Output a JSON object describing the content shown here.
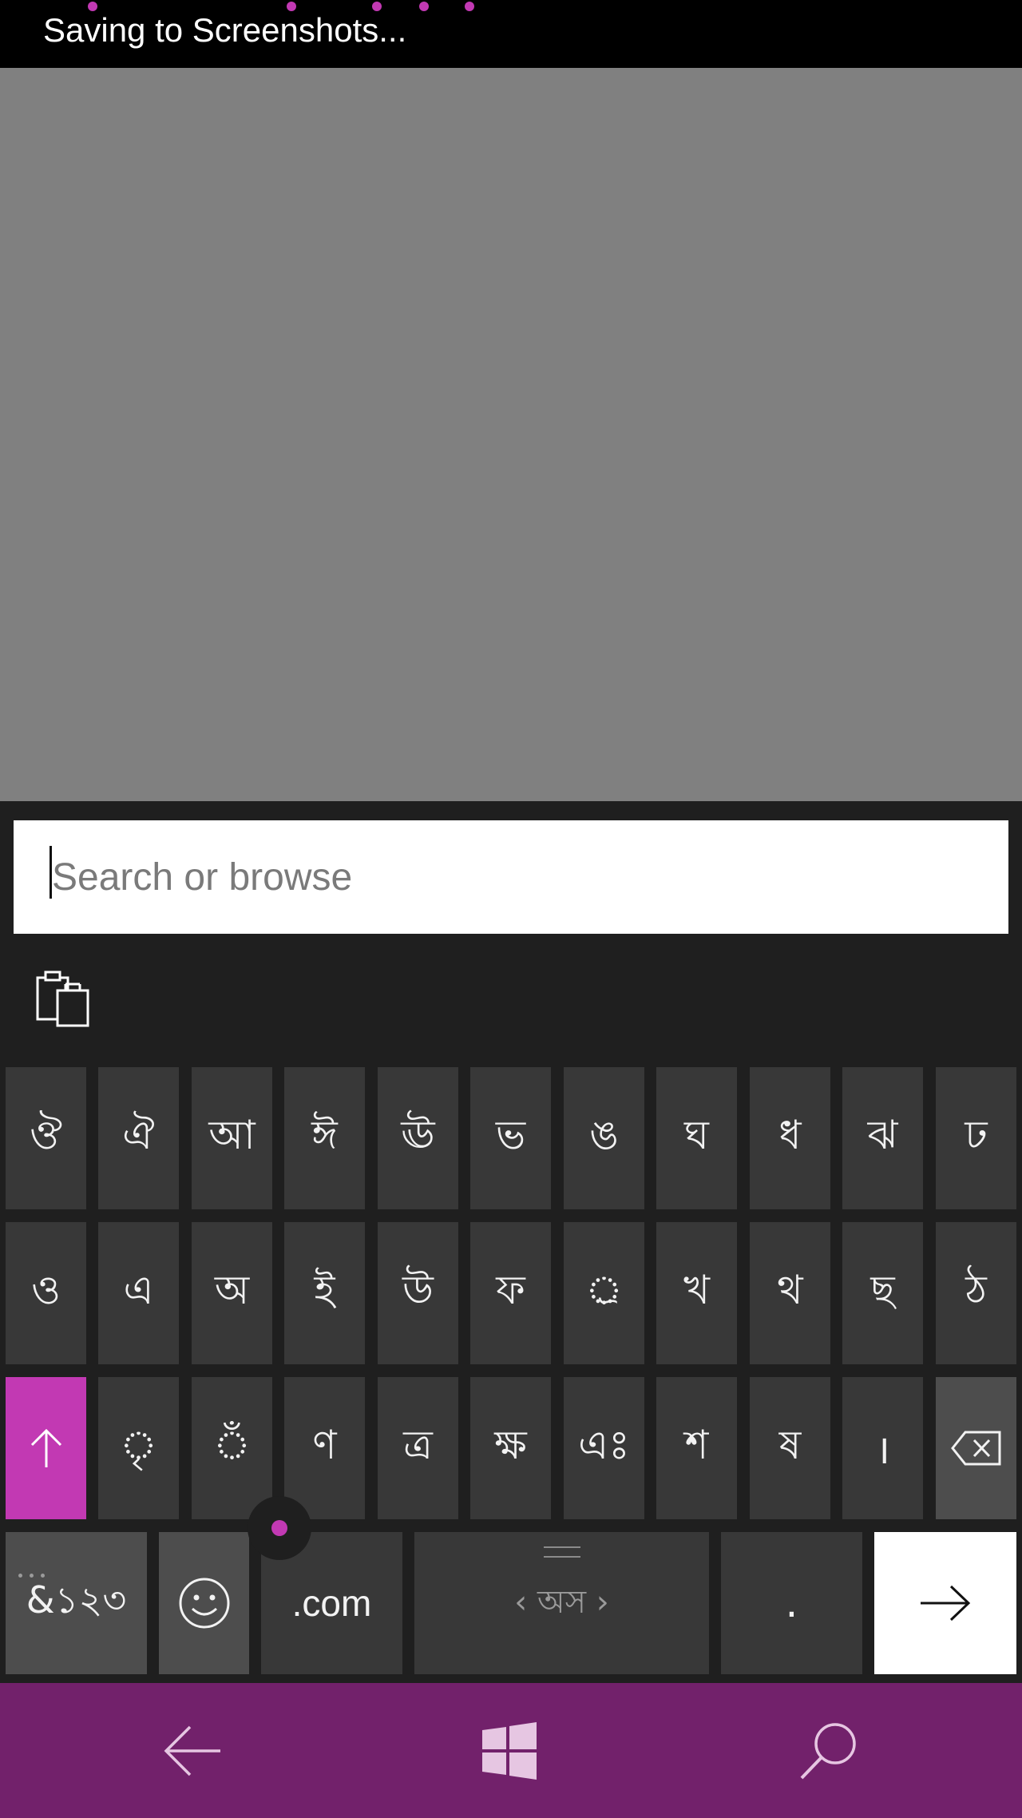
{
  "status": {
    "text": "Saving to Screenshots..."
  },
  "search": {
    "placeholder": "Search or browse",
    "value": ""
  },
  "keyboard": {
    "row1": [
      "ঔ",
      "ঐ",
      "আ",
      "ঈ",
      "ঊ",
      "ভ",
      "ঙ",
      "ঘ",
      "ধ",
      "ঝ",
      "ঢ"
    ],
    "row2": [
      "ও",
      "এ",
      "অ",
      "ই",
      "উ",
      "ফ",
      "্ৰ",
      "খ",
      "থ",
      "ছ",
      "ঠ"
    ],
    "row3": [
      "ৃ",
      "ঁ",
      "ণ",
      "ত্ৰ",
      "ক্ষ",
      "এঃ",
      "শ",
      "ষ",
      "।"
    ],
    "symbols_label": "&১২৩",
    "dotcom_label": ".com",
    "space_label": "‹ অস ›",
    "period_label": "."
  },
  "colors": {
    "accent": "#c239b3",
    "navbar": "#72216b",
    "key_bg": "#383838",
    "panel_bg": "#1f1f1f"
  },
  "icons": {
    "clipboard": "clipboard-icon",
    "shift": "arrow-up-icon",
    "backspace": "backspace-icon",
    "emoji": "smiley-icon",
    "enter": "arrow-right-icon",
    "back": "back-arrow-icon",
    "home": "windows-logo-icon",
    "search": "search-icon"
  }
}
